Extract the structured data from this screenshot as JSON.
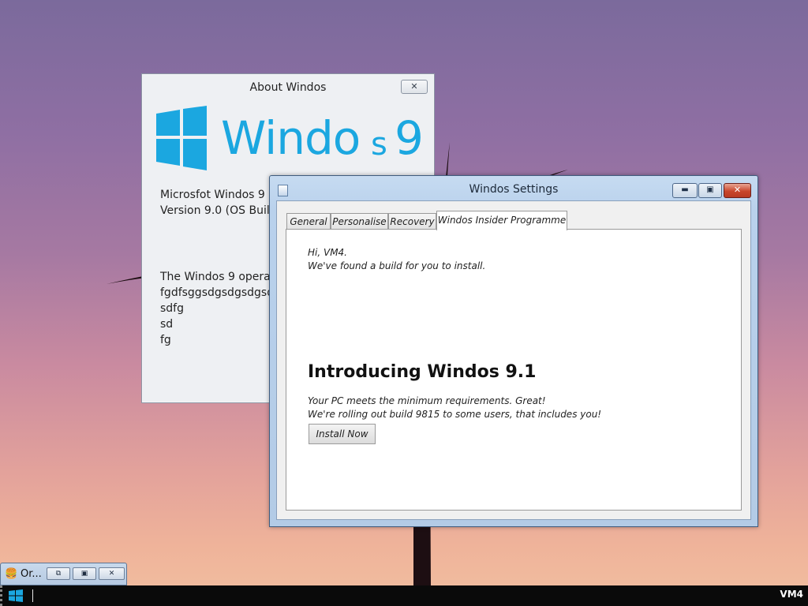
{
  "about": {
    "title": "About Windos",
    "close_icon": "close-icon",
    "logo": {
      "word_main": "Windo",
      "word_s": "s",
      "word_num": "9"
    },
    "info": [
      "Microsfot Windos 9 S",
      "Version 9.0 (OS Build"
    ],
    "desc": [
      "The Windos 9 operat",
      "fgdfsggsdgsdgsdgsd",
      "sdfg",
      "sd",
      "fg"
    ]
  },
  "settings": {
    "title": "Windos Settings",
    "tabs": [
      "General",
      "Personalise",
      "Recovery",
      "Windos Insider Programme"
    ],
    "active_tab": "Windos Insider Programme",
    "greeting": [
      "Hi, VM4.",
      "We've found a build for you to install."
    ],
    "headline": "Introducing Windos 9.1",
    "details": [
      "Your PC meets the minimum requirements. Great!",
      "We're rolling out build 9815 to some users, that includes you!"
    ],
    "install_button": "Install Now",
    "caption_buttons": {
      "minimize": "minimize-icon",
      "maximize": "maximize-icon",
      "close": "close-icon"
    }
  },
  "minimized_window": {
    "title": "Or...",
    "icon": "burger-icon"
  },
  "taskbar": {
    "user": "VM4",
    "start_icon": "windows-logo-icon"
  },
  "colors": {
    "brand_blue": "#1ba7e0",
    "close_red": "#c9462c",
    "taskbar": "#0a0a0a"
  }
}
